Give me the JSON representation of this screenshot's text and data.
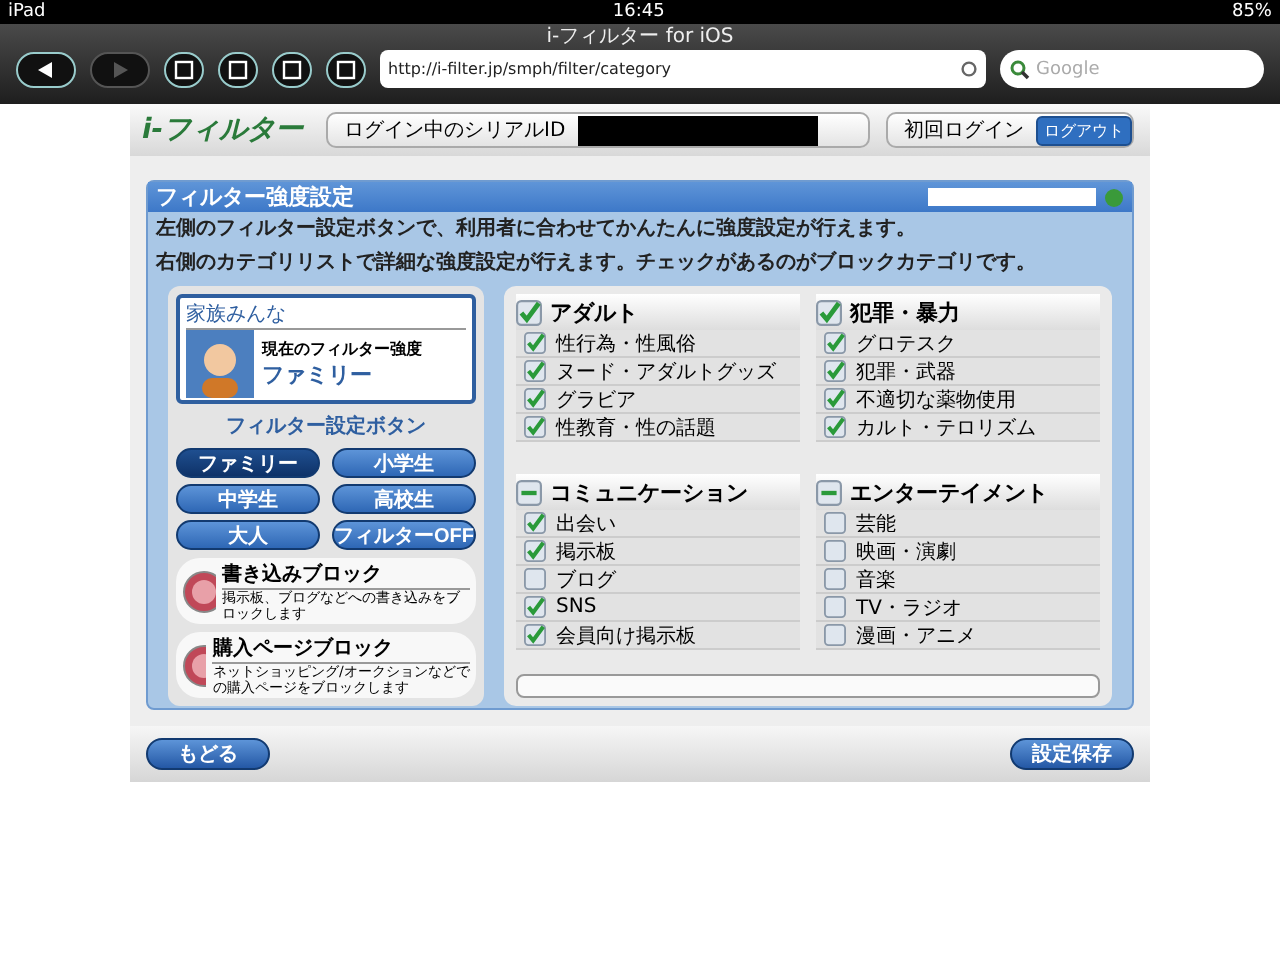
{
  "status_bar": {
    "device": "iPad",
    "time": "16:45",
    "battery": "85%"
  },
  "browser": {
    "title": "i-フィルター for iOS",
    "url": "http://i-filter.jp/smph/filter/category",
    "search_placeholder": "Google"
  },
  "header": {
    "logo": "i-フィルター",
    "serial_label": "ログイン中のシリアルID",
    "first_login": "初回ログイン",
    "logout": "ログアウト"
  },
  "panel": {
    "title": "フィルター強度設定",
    "description": [
      "左側のフィルター設定ボタンで、利用者に合わせてかんたんに強度設定が行えます。",
      "右側のカテゴリリストで詳細な強度設定が行えます。チェックがあるのがブロックカテゴリです。"
    ]
  },
  "profile": {
    "user": "家族みんな",
    "current_label": "現在のフィルター強度",
    "current_level": "ファミリー"
  },
  "filter_buttons_title": "フィルター設定ボタン",
  "filter_buttons": [
    {
      "label": "ファミリー",
      "selected": true
    },
    {
      "label": "小学生",
      "selected": false
    },
    {
      "label": "中学生",
      "selected": false
    },
    {
      "label": "高校生",
      "selected": false
    },
    {
      "label": "大人",
      "selected": false
    },
    {
      "label": "フィルターOFF",
      "selected": false
    }
  ],
  "blocks": [
    {
      "title": "書き込みブロック",
      "description": "掲示板、ブログなどへの書き込みをブロックします"
    },
    {
      "title": "購入ページブロック",
      "description": "ネットショッピング/オークションなどでの購入ページをブロックします"
    }
  ],
  "categories": [
    {
      "name": "アダルト",
      "checked": true,
      "mixed": false,
      "items": [
        {
          "label": "性行為・性風俗",
          "checked": true
        },
        {
          "label": "ヌード・アダルトグッズ",
          "checked": true
        },
        {
          "label": "グラビア",
          "checked": true
        },
        {
          "label": "性教育・性の話題",
          "checked": true
        }
      ]
    },
    {
      "name": "犯罪・暴力",
      "checked": true,
      "mixed": false,
      "items": [
        {
          "label": "グロテスク",
          "checked": true
        },
        {
          "label": "犯罪・武器",
          "checked": true
        },
        {
          "label": "不適切な薬物使用",
          "checked": true
        },
        {
          "label": "カルト・テロリズム",
          "checked": true
        }
      ]
    },
    {
      "name": "コミュニケーション",
      "checked": false,
      "mixed": true,
      "items": [
        {
          "label": "出会い",
          "checked": true
        },
        {
          "label": "掲示板",
          "checked": true
        },
        {
          "label": "ブログ",
          "checked": false
        },
        {
          "label": "SNS",
          "checked": true
        },
        {
          "label": "会員向け掲示板",
          "checked": true
        }
      ]
    },
    {
      "name": "エンターテイメント",
      "checked": false,
      "mixed": true,
      "items": [
        {
          "label": "芸能",
          "checked": false
        },
        {
          "label": "映画・演劇",
          "checked": false
        },
        {
          "label": "音楽",
          "checked": false
        },
        {
          "label": "TV・ラジオ",
          "checked": false
        },
        {
          "label": "漫画・アニメ",
          "checked": false
        }
      ]
    }
  ],
  "footer": {
    "back": "もどる",
    "save": "設定保存"
  }
}
